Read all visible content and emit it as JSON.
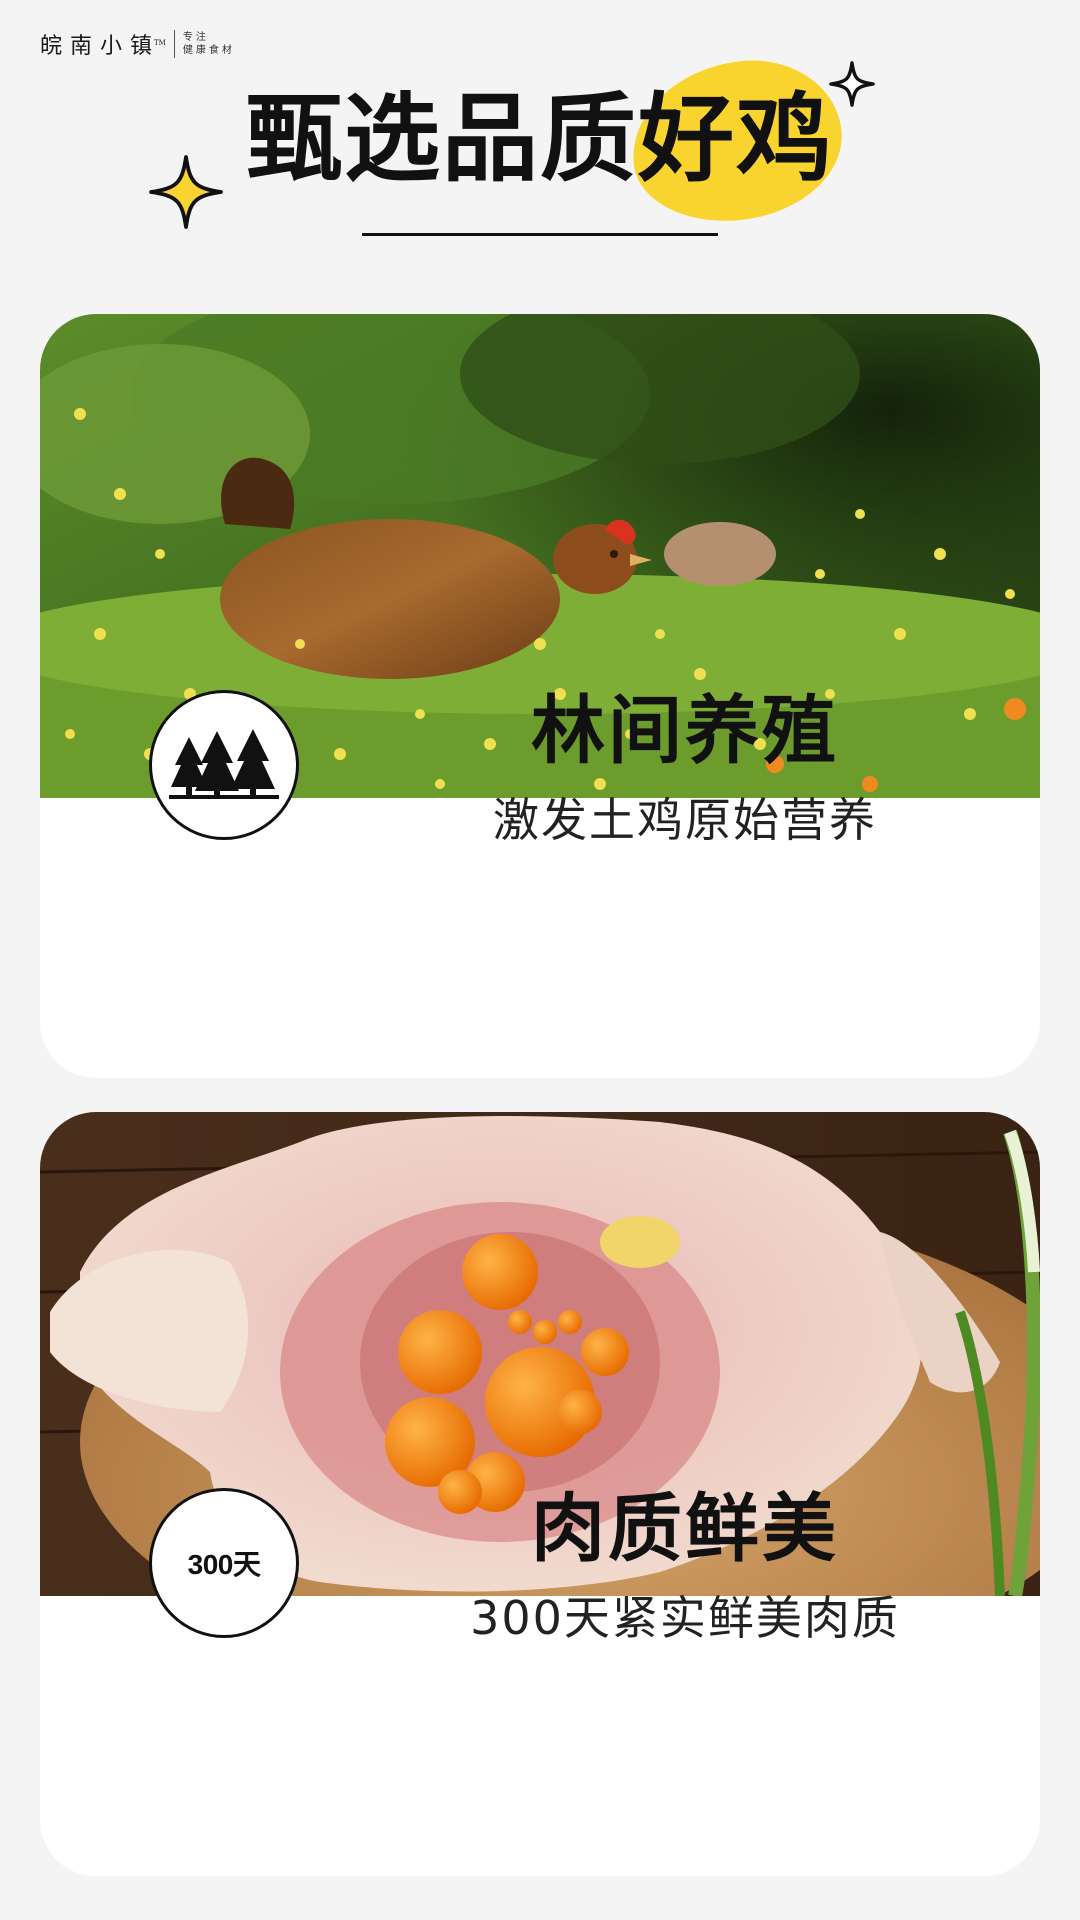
{
  "brand": {
    "name": "皖南小镇",
    "trademark": "TM",
    "slogan_line1": "专注",
    "slogan_line2": "健康食材"
  },
  "header": {
    "title": "甄选品质好鸡"
  },
  "colors": {
    "accent_yellow": "#f9d42e",
    "background": "#f4f4f4",
    "card": "#ffffff",
    "text": "#111111"
  },
  "features": [
    {
      "photo": "hen-in-meadow-photo",
      "icon": "forest-trees-icon",
      "title": "林间养殖",
      "subtitle": "激发土鸡原始营养"
    },
    {
      "photo": "raw-chicken-with-egg-yolks-photo",
      "badge": "300天",
      "title": "肉质鲜美",
      "subtitle": "300天紧实鲜美肉质"
    }
  ]
}
